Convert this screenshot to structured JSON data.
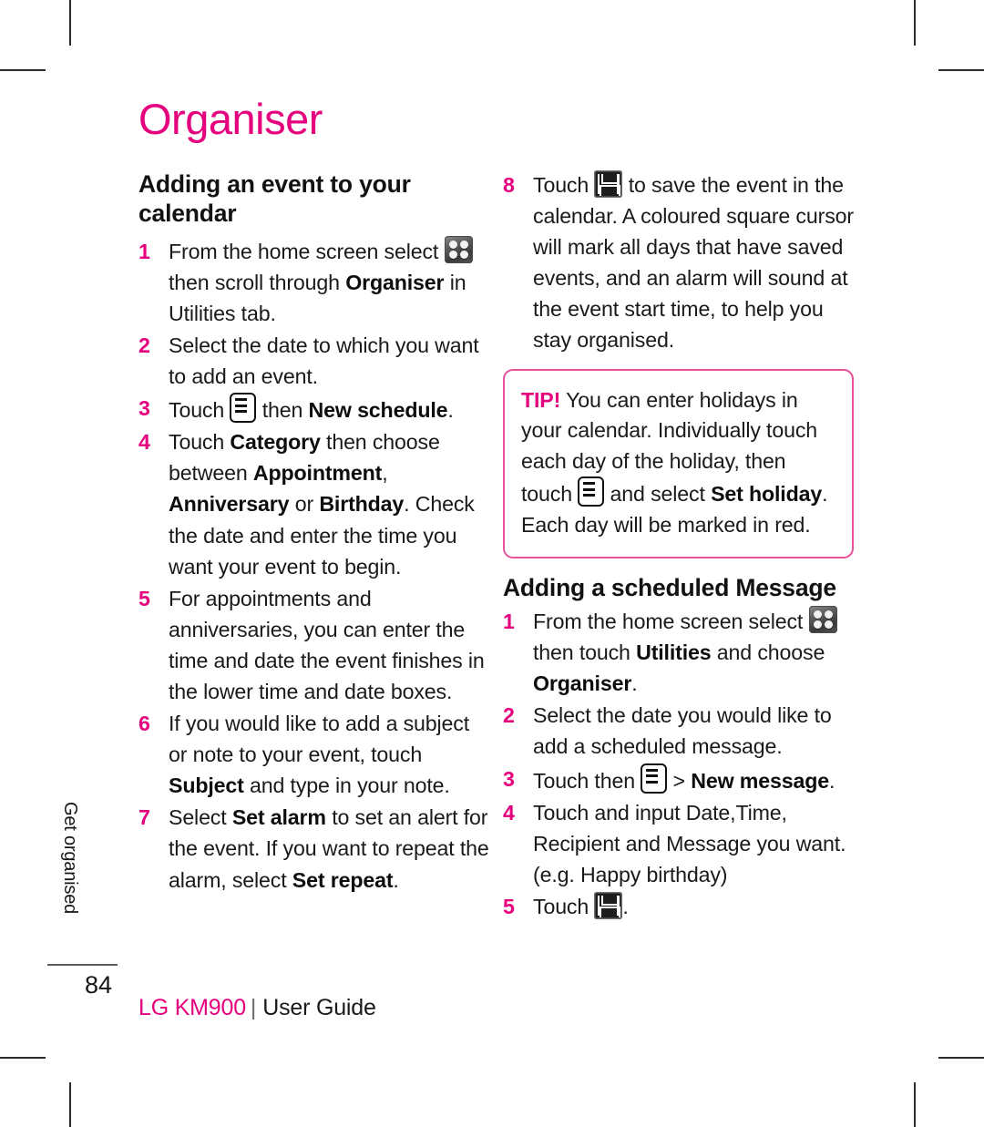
{
  "document": {
    "page_title": "Organiser",
    "page_number": "84",
    "side_tab": "Get organised",
    "footer": {
      "brand": "LG KM900",
      "separator": "|",
      "label": "User Guide"
    },
    "colors": {
      "magenta": "#e5007d",
      "tip_border": "#e8509b",
      "text": "#1a1a1a"
    }
  },
  "left_column": {
    "heading": "Adding an event to your calendar",
    "steps": [
      {
        "num": "1",
        "parts": [
          {
            "t": "text",
            "v": "From the home screen select "
          },
          {
            "t": "icon",
            "v": "grid-launcher-icon"
          },
          {
            "t": "text",
            "v": " then scroll through "
          },
          {
            "t": "bold",
            "v": "Organiser"
          },
          {
            "t": "text",
            "v": " in Utilities tab."
          }
        ]
      },
      {
        "num": "2",
        "parts": [
          {
            "t": "text",
            "v": "Select the date to which you want to add an event."
          }
        ]
      },
      {
        "num": "3",
        "parts": [
          {
            "t": "text",
            "v": "Touch "
          },
          {
            "t": "icon",
            "v": "menu-icon"
          },
          {
            "t": "text",
            "v": " then "
          },
          {
            "t": "bold",
            "v": "New schedule"
          },
          {
            "t": "text",
            "v": "."
          }
        ]
      },
      {
        "num": "4",
        "parts": [
          {
            "t": "text",
            "v": "Touch "
          },
          {
            "t": "bold",
            "v": "Category"
          },
          {
            "t": "text",
            "v": " then choose between "
          },
          {
            "t": "bold",
            "v": "Appointment"
          },
          {
            "t": "text",
            "v": ", "
          },
          {
            "t": "bold",
            "v": "Anniversary"
          },
          {
            "t": "text",
            "v": " or "
          },
          {
            "t": "bold",
            "v": "Birthday"
          },
          {
            "t": "text",
            "v": ". Check the date and enter the time you want your event to begin."
          }
        ]
      },
      {
        "num": "5",
        "parts": [
          {
            "t": "text",
            "v": "For appointments and anniversaries, you can enter the time and date the event finishes in the lower time and date boxes."
          }
        ]
      },
      {
        "num": "6",
        "parts": [
          {
            "t": "text",
            "v": "If you would like to add a subject or note to your event, touch "
          },
          {
            "t": "bold",
            "v": "Subject"
          },
          {
            "t": "text",
            "v": " and type in your note."
          }
        ]
      },
      {
        "num": "7",
        "parts": [
          {
            "t": "text",
            "v": "Select "
          },
          {
            "t": "bold",
            "v": "Set alarm"
          },
          {
            "t": "text",
            "v": " to set an alert for the event. If you want to repeat the alarm, select "
          },
          {
            "t": "bold",
            "v": "Set repeat"
          },
          {
            "t": "text",
            "v": "."
          }
        ]
      }
    ]
  },
  "right_column": {
    "steps_continued": [
      {
        "num": "8",
        "parts": [
          {
            "t": "text",
            "v": "Touch "
          },
          {
            "t": "icon",
            "v": "save-icon"
          },
          {
            "t": "text",
            "v": " to save the event in the calendar. A coloured square cursor will mark all days that have saved events, and an alarm will sound at the event start time, to help you stay organised."
          }
        ]
      }
    ],
    "tip": {
      "label": "TIP!",
      "parts": [
        {
          "t": "text",
          "v": " You can enter holidays in your calendar. Individually touch each day of the holiday, then touch "
        },
        {
          "t": "icon",
          "v": "menu-icon"
        },
        {
          "t": "text",
          "v": " and select "
        },
        {
          "t": "bold",
          "v": "Set holiday"
        },
        {
          "t": "text",
          "v": ". Each day will be marked in red."
        }
      ]
    },
    "heading": "Adding a scheduled Message",
    "steps": [
      {
        "num": "1",
        "parts": [
          {
            "t": "text",
            "v": "From the home screen select "
          },
          {
            "t": "icon",
            "v": "grid-launcher-icon"
          },
          {
            "t": "text",
            "v": " then touch "
          },
          {
            "t": "bold",
            "v": "Utilities"
          },
          {
            "t": "text",
            "v": " and choose "
          },
          {
            "t": "bold",
            "v": "Organiser"
          },
          {
            "t": "text",
            "v": "."
          }
        ]
      },
      {
        "num": "2",
        "parts": [
          {
            "t": "text",
            "v": "Select the date you would like to add a scheduled message."
          }
        ]
      },
      {
        "num": "3",
        "parts": [
          {
            "t": "text",
            "v": "Touch then "
          },
          {
            "t": "icon",
            "v": "menu-icon"
          },
          {
            "t": "text",
            "v": " > "
          },
          {
            "t": "bold",
            "v": "New message"
          },
          {
            "t": "text",
            "v": "."
          }
        ]
      },
      {
        "num": "4",
        "parts": [
          {
            "t": "text",
            "v": "Touch and input Date,Time, Recipient and Message you want.(e.g. Happy birthday)"
          }
        ]
      },
      {
        "num": "5",
        "parts": [
          {
            "t": "text",
            "v": "Touch "
          },
          {
            "t": "icon",
            "v": "save-icon"
          },
          {
            "t": "text",
            "v": "."
          }
        ]
      }
    ]
  }
}
